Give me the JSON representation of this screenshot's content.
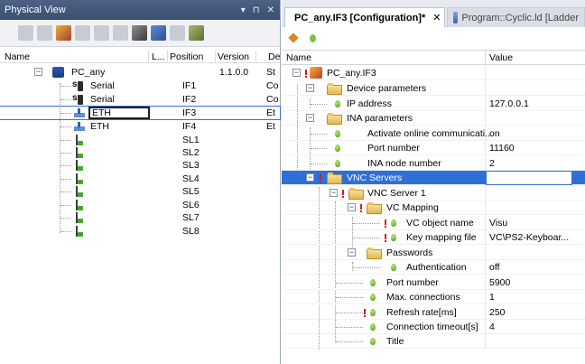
{
  "left_panel": {
    "title": "Physical View",
    "title_controls": [
      "▾",
      "⊓",
      "✕"
    ],
    "toolbar_icons": [
      "toolbar-icon-1",
      "toolbar-icon-2",
      "toolbar-icon-3",
      "toolbar-icon-4",
      "toolbar-icon-5",
      "toolbar-icon-6",
      "toolbar-icon-7",
      "toolbar-icon-8",
      "toolbar-icon-9",
      "toolbar-icon-10"
    ],
    "columns": {
      "name": "Name",
      "l": "L...",
      "position": "Position",
      "version": "Version",
      "de": "De"
    },
    "rows": [
      {
        "name": "PC_any",
        "position": "",
        "version": "1.1.0.0",
        "de": "St",
        "icon": "pc-icon"
      },
      {
        "name": "Serial",
        "position": "IF1",
        "version": "",
        "de": "Co",
        "icon": "serial-icon"
      },
      {
        "name": "Serial",
        "position": "IF2",
        "version": "",
        "de": "Co",
        "icon": "serial-icon"
      },
      {
        "name": "ETH",
        "position": "IF3",
        "version": "",
        "de": "Et",
        "icon": "ethernet-icon"
      },
      {
        "name": "ETH",
        "position": "IF4",
        "version": "",
        "de": "Et",
        "icon": "ethernet-icon"
      },
      {
        "name": "",
        "position": "SL1",
        "version": "",
        "de": "",
        "icon": "slot-icon"
      },
      {
        "name": "",
        "position": "SL2",
        "version": "",
        "de": "",
        "icon": "slot-icon"
      },
      {
        "name": "",
        "position": "SL3",
        "version": "",
        "de": "",
        "icon": "slot-icon"
      },
      {
        "name": "",
        "position": "SL4",
        "version": "",
        "de": "",
        "icon": "slot-icon"
      },
      {
        "name": "",
        "position": "SL5",
        "version": "",
        "de": "",
        "icon": "slot-icon"
      },
      {
        "name": "",
        "position": "SL6",
        "version": "",
        "de": "",
        "icon": "slot-icon"
      },
      {
        "name": "",
        "position": "SL7",
        "version": "",
        "de": "",
        "icon": "slot-icon"
      },
      {
        "name": "",
        "position": "SL8",
        "version": "",
        "de": "",
        "icon": "slot-icon"
      }
    ]
  },
  "right_panel": {
    "tabs": [
      {
        "label": "PC_any.IF3 [Configuration]*",
        "close": "✕",
        "active": true
      },
      {
        "label": "Program::Cyclic.ld [Ladder",
        "active": false
      }
    ],
    "columns": {
      "name": "Name",
      "value": "Value"
    },
    "rows": [
      {
        "name": "PC_any.IF3",
        "value": "",
        "icon": "config-icon"
      },
      {
        "name": "Device parameters",
        "value": "",
        "icon": "folder-icon"
      },
      {
        "name": "IP address",
        "value": "127.0.0.1",
        "icon": "parameter-icon"
      },
      {
        "name": "INA parameters",
        "value": "",
        "icon": "folder-icon"
      },
      {
        "name": "Activate online communicati...",
        "value": "on",
        "icon": "parameter-icon"
      },
      {
        "name": "Port number",
        "value": "11160",
        "icon": "parameter-icon"
      },
      {
        "name": "INA node number",
        "value": "2",
        "icon": "parameter-icon"
      },
      {
        "name": "VNC Servers",
        "value": "",
        "icon": "folder-icon"
      },
      {
        "name": "VNC Server 1",
        "value": "",
        "icon": "folder-icon"
      },
      {
        "name": "VC Mapping",
        "value": "",
        "icon": "folder-icon"
      },
      {
        "name": "VC object name",
        "value": "Visu",
        "icon": "parameter-icon"
      },
      {
        "name": "Key mapping file",
        "value": "VC\\PS2-Keyboar...",
        "icon": "parameter-icon"
      },
      {
        "name": "Passwords",
        "value": "",
        "icon": "folder-icon"
      },
      {
        "name": "Authentication",
        "value": "off",
        "icon": "parameter-icon"
      },
      {
        "name": "Port number",
        "value": "5900",
        "icon": "parameter-icon"
      },
      {
        "name": "Max. connections",
        "value": "1",
        "icon": "parameter-icon"
      },
      {
        "name": "Refresh rate[ms]",
        "value": "250",
        "icon": "parameter-icon"
      },
      {
        "name": "Connection timeout[s]",
        "value": "4",
        "icon": "parameter-icon"
      },
      {
        "name": "Title",
        "value": "",
        "icon": "parameter-icon"
      }
    ]
  }
}
